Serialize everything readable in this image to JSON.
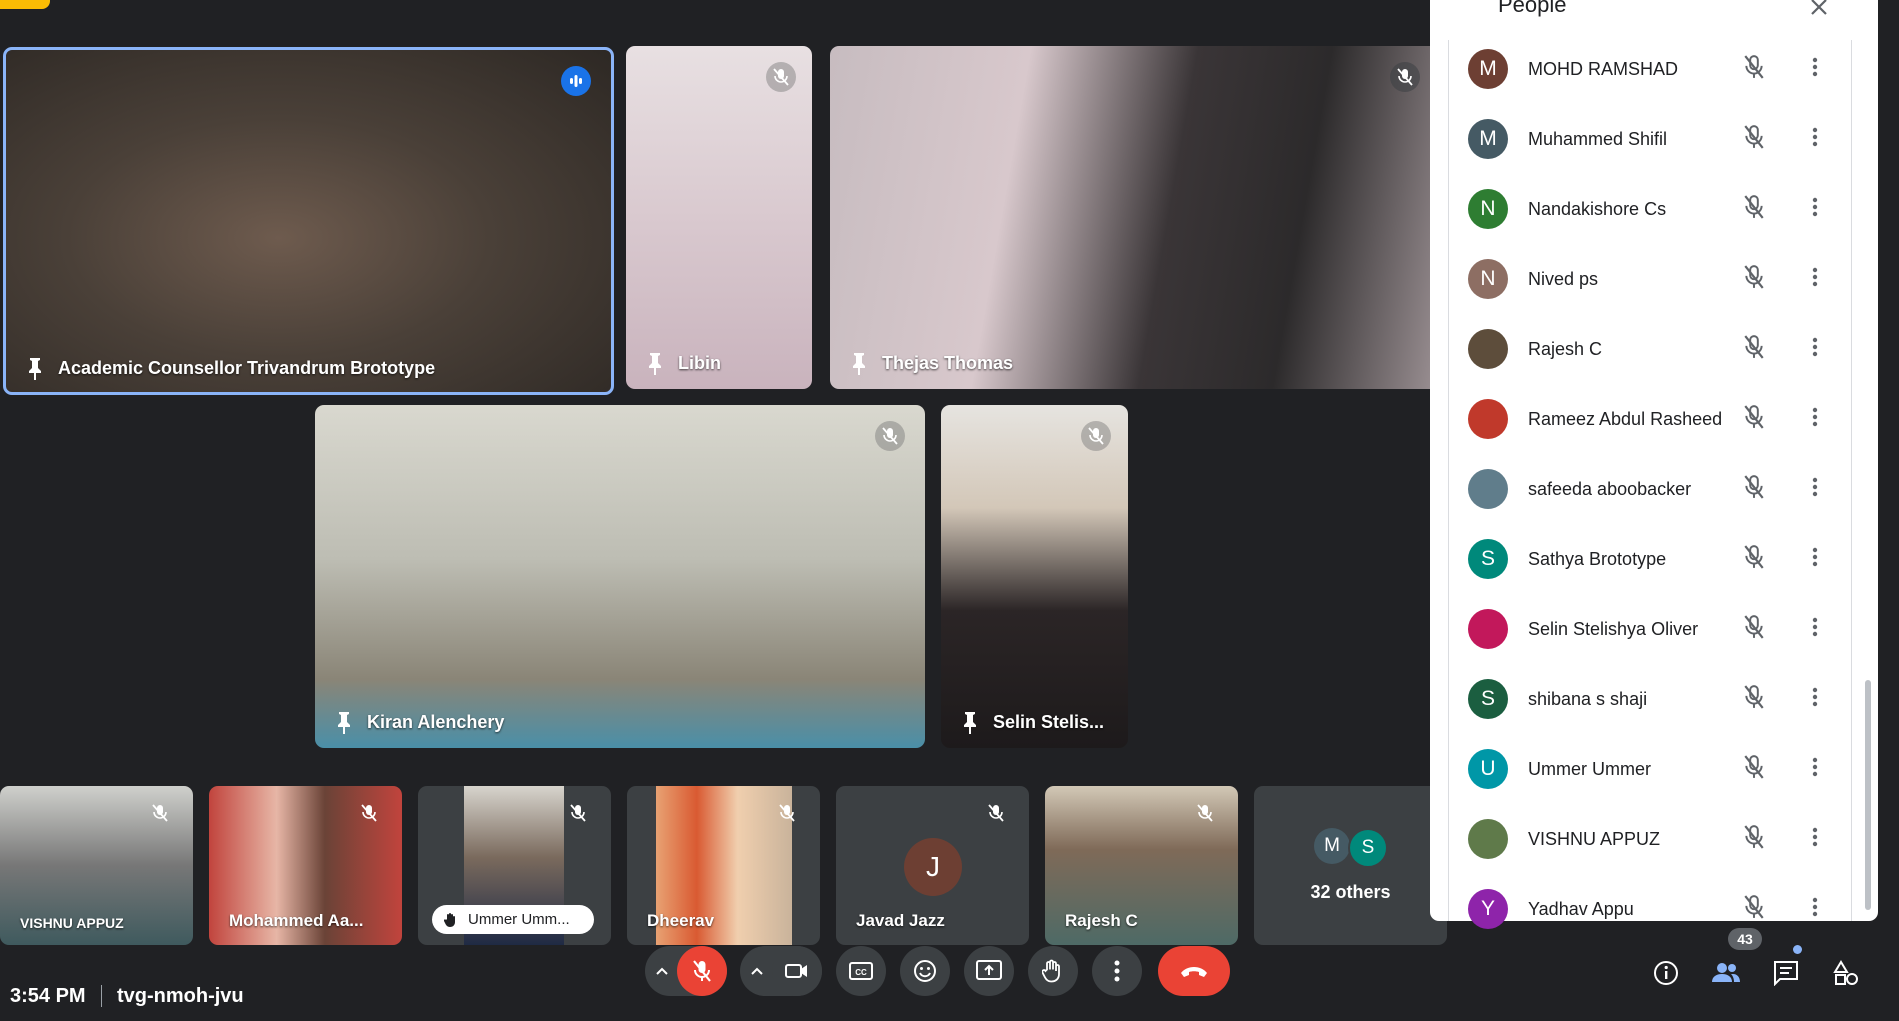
{
  "meeting": {
    "time": "3:54 PM",
    "code": "tvg-nmoh-jvu"
  },
  "tiles": {
    "t1": {
      "name": "Academic Counsellor Trivandrum Brototype"
    },
    "t2": {
      "name": "Libin"
    },
    "t3": {
      "name": "Thejas Thomas"
    },
    "t4": {
      "name": "Kiran Alenchery"
    },
    "t5": {
      "name": "Selin Stelis..."
    }
  },
  "strip": {
    "s1": {
      "name": "VISHNU APPUZ"
    },
    "s2": {
      "name": "Mohammed Aa..."
    },
    "s3": {
      "name": "Ummer Umm..."
    },
    "s4": {
      "name": "Dheerav"
    },
    "s5": {
      "name": "Javad Jazz",
      "initial": "J"
    },
    "s6": {
      "name": "Rajesh C"
    },
    "others": {
      "label": "32 others",
      "a1": "M",
      "a2": "S"
    }
  },
  "people_panel": {
    "title": "People",
    "participants": [
      {
        "name": "MOHD RAMSHAD",
        "initial": "M",
        "color": "#6d3f33"
      },
      {
        "name": "Muhammed Shifil",
        "initial": "M",
        "color": "#455a64"
      },
      {
        "name": "Nandakishore Cs",
        "initial": "N",
        "color": "#2e7d32"
      },
      {
        "name": "Nived ps",
        "initial": "N",
        "color": "#8d6e63"
      },
      {
        "name": "Rajesh C",
        "initial": "",
        "color": "#5d4d3b"
      },
      {
        "name": "Rameez Abdul Rasheed",
        "initial": "",
        "color": "#c0392b"
      },
      {
        "name": "safeeda aboobacker",
        "initial": "",
        "color": "#607d8b"
      },
      {
        "name": "Sathya Brototype",
        "initial": "S",
        "color": "#00897b"
      },
      {
        "name": "Selin Stelishya Oliver",
        "initial": "",
        "color": "#c2185b"
      },
      {
        "name": "shibana s shaji",
        "initial": "S",
        "color": "#1b5e40"
      },
      {
        "name": "Ummer Ummer",
        "initial": "U",
        "color": "#0097a7"
      },
      {
        "name": "VISHNU APPUZ",
        "initial": "",
        "color": "#5f7a4a"
      },
      {
        "name": "Yadhav Appu",
        "initial": "Y",
        "color": "#8e24aa"
      }
    ]
  },
  "participant_count": "43",
  "colors": {
    "background": "#202124",
    "hangup": "#ea4335",
    "speaking": "#1a73e8",
    "tray": "#3c4043",
    "yellow": "#fbbc04"
  }
}
